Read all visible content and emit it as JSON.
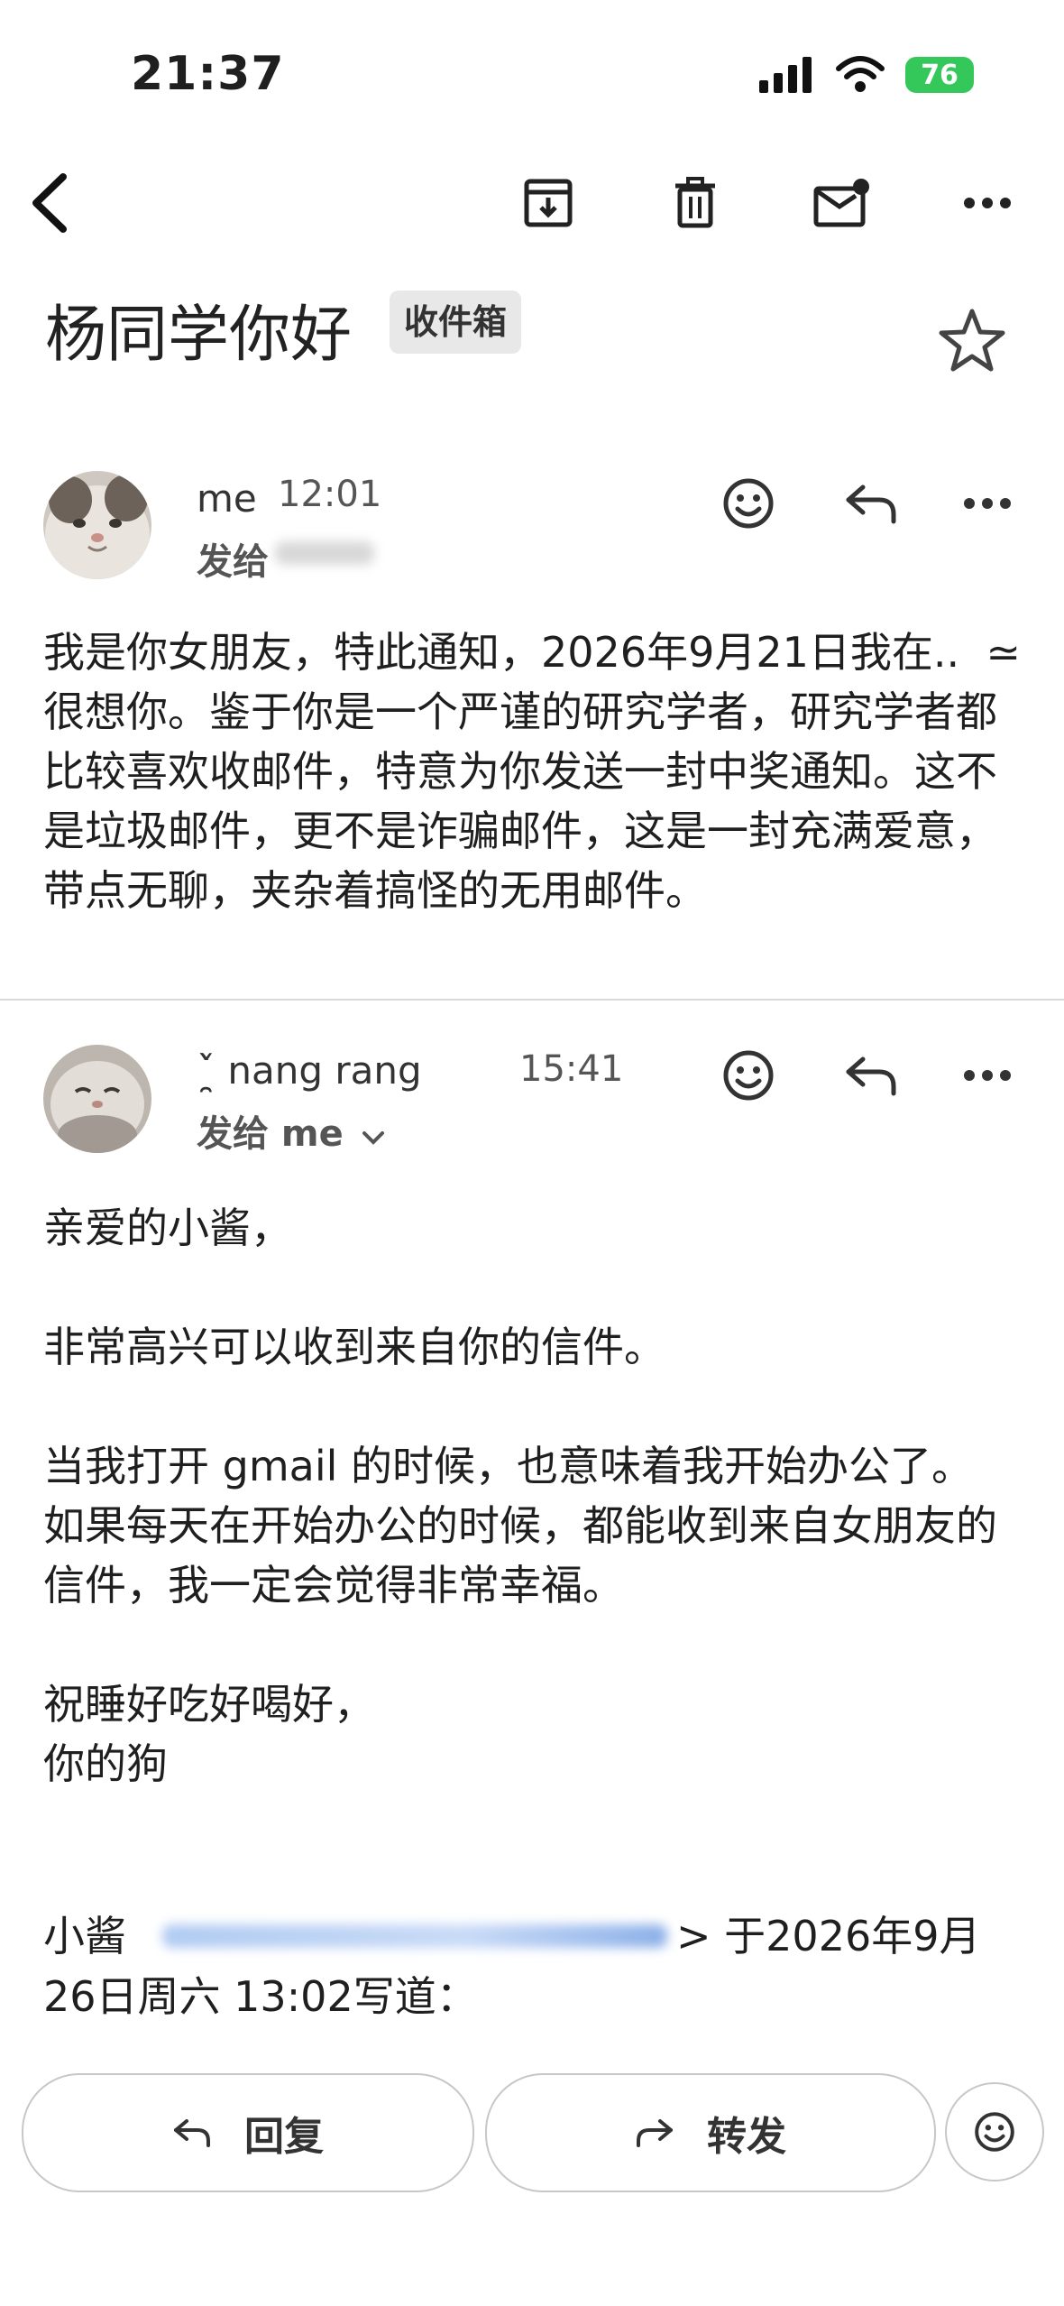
{
  "status_bar": {
    "time": "21:37",
    "battery": "76"
  },
  "email": {
    "subject": "杨同学你好",
    "label": "收件箱",
    "messages": [
      {
        "sender": "me",
        "time": "12:01",
        "recipient": "发给",
        "body": "我是你女朋友，特此通知，2026年9月21日我在..  ≃很想你。鉴于你是一个严谨的研究学者，研究学者都比较喜欢收邮件，特意为你发送一封中奖通知。这不是垃圾邮件，更不是诈骗邮件，这是一封充满爱意，带点无聊，夹杂着搞怪的无用邮件。"
      },
      {
        "sender": "ˇ̯̀    nang rang",
        "time": "15:41",
        "recipient": "发给 me",
        "body": "亲爱的小酱，\n\n非常高兴可以收到来自你的信件。\n\n当我打开 gmail 的时候，也意味着我开始办公了。\n如果每天在开始办公的时候，都能收到来自女朋友的信件，我一定会觉得非常幸福。\n\n祝睡好吃好喝好，\n你的狗",
        "quote_prefix": "小酱",
        "quote_suffix": "> 于2026年9月",
        "quote_line2": "26日周六 13:02写道："
      }
    ]
  },
  "actions": {
    "reply": "回复",
    "forward": "转发"
  },
  "colors": {
    "accent_link": "#1a73e8",
    "battery": "#34c759"
  }
}
